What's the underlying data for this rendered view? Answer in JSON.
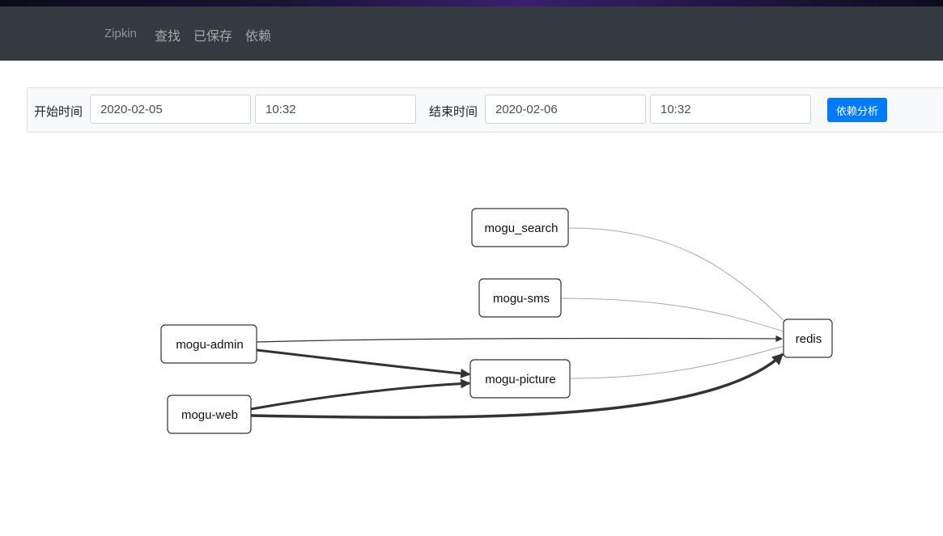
{
  "navbar": {
    "brand": "Zipkin",
    "links": [
      "查找",
      "已保存",
      "依赖"
    ]
  },
  "toolbar": {
    "start_label": "开始时间",
    "start_date": "2020-02-05",
    "start_time": "10:32",
    "end_label": "结束时间",
    "end_date": "2020-02-06",
    "end_time": "10:32",
    "analyze_button": "依赖分析"
  },
  "graph": {
    "nodes": [
      {
        "id": "mogu_search",
        "label": "mogu_search"
      },
      {
        "id": "mogu-sms",
        "label": "mogu-sms"
      },
      {
        "id": "mogu-admin",
        "label": "mogu-admin"
      },
      {
        "id": "mogu-picture",
        "label": "mogu-picture"
      },
      {
        "id": "mogu-web",
        "label": "mogu-web"
      },
      {
        "id": "redis",
        "label": "redis"
      }
    ],
    "edges": [
      {
        "from": "mogu_search",
        "to": "redis"
      },
      {
        "from": "mogu-sms",
        "to": "redis"
      },
      {
        "from": "mogu-admin",
        "to": "redis"
      },
      {
        "from": "mogu-admin",
        "to": "mogu-picture"
      },
      {
        "from": "mogu-picture",
        "to": "redis"
      },
      {
        "from": "mogu-web",
        "to": "mogu-picture"
      },
      {
        "from": "mogu-web",
        "to": "redis"
      }
    ]
  },
  "colors": {
    "navbar_bg": "#343a40",
    "primary_button": "#007bff",
    "edge_dark": "#333333",
    "edge_light": "#aaaaaa"
  }
}
